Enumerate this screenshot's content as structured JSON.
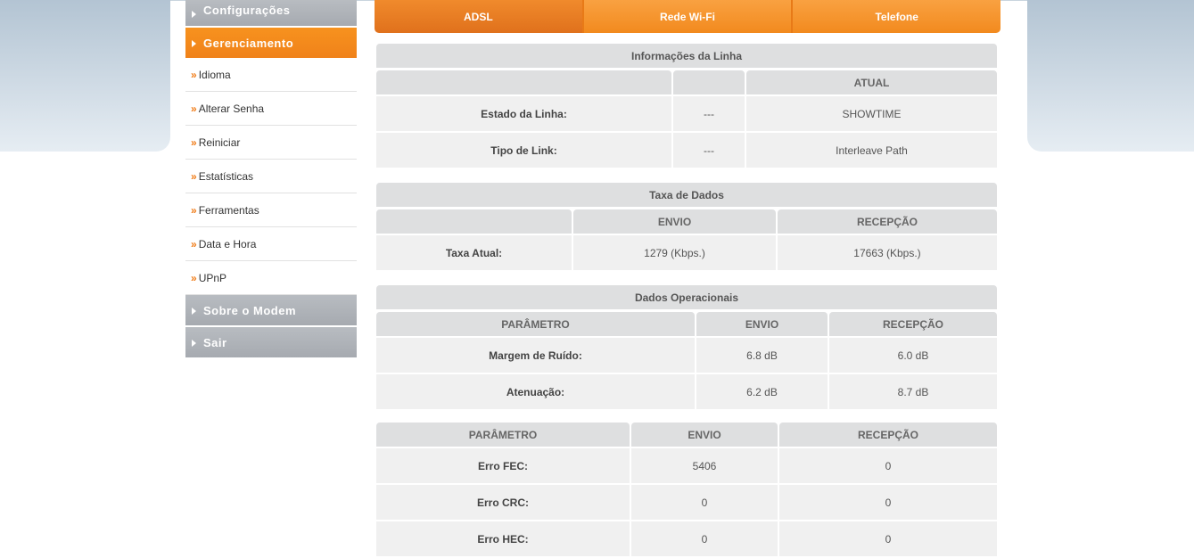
{
  "sidebar": {
    "sections": [
      {
        "label": "Configurações"
      },
      {
        "label": "Gerenciamento"
      },
      {
        "label": "Sobre o Modem"
      },
      {
        "label": "Sair"
      }
    ],
    "items": [
      {
        "label": "Idioma"
      },
      {
        "label": "Alterar Senha"
      },
      {
        "label": "Reiniciar"
      },
      {
        "label": "Estatísticas"
      },
      {
        "label": "Ferramentas"
      },
      {
        "label": "Data e Hora"
      },
      {
        "label": "UPnP"
      }
    ],
    "arrow": "»"
  },
  "tabs": [
    "ADSL",
    "Rede Wi-Fi",
    "Telefone"
  ],
  "linha": {
    "title": "Informações da Linha",
    "header": [
      "",
      "",
      "ATUAL"
    ],
    "rows": [
      {
        "label": "Estado da Linha:",
        "mid": "---",
        "atual": "SHOWTIME"
      },
      {
        "label": "Tipo de Link:",
        "mid": "---",
        "atual": "Interleave Path"
      }
    ]
  },
  "taxa": {
    "title": "Taxa de Dados",
    "header": [
      "",
      "ENVIO",
      "RECEPÇÃO"
    ],
    "rows": [
      {
        "label": "Taxa Atual:",
        "envio": "1279 (Kbps.)",
        "recepcao": "17663 (Kbps.)"
      }
    ]
  },
  "operacionais": {
    "title": "Dados Operacionais",
    "header": [
      "PARÂMETRO",
      "ENVIO",
      "RECEPÇÃO"
    ],
    "rows": [
      {
        "label": "Margem de Ruído:",
        "envio": "6.8 dB",
        "recepcao": "6.0 dB"
      },
      {
        "label": "Atenuação:",
        "envio": "6.2 dB",
        "recepcao": "8.7 dB"
      }
    ]
  },
  "erros": {
    "header": [
      "PARÂMETRO",
      "ENVIO",
      "RECEPÇÃO"
    ],
    "rows": [
      {
        "label": "Erro FEC:",
        "envio": "5406",
        "recepcao": "0"
      },
      {
        "label": "Erro CRC:",
        "envio": "0",
        "recepcao": "0"
      },
      {
        "label": "Erro HEC:",
        "envio": "0",
        "recepcao": "0"
      }
    ]
  },
  "colors": {
    "accent": "#f28a1e",
    "nav_gray": "#a6aab0",
    "cell_bg": "#f0f0f0",
    "header_bg": "#dedfe0"
  }
}
